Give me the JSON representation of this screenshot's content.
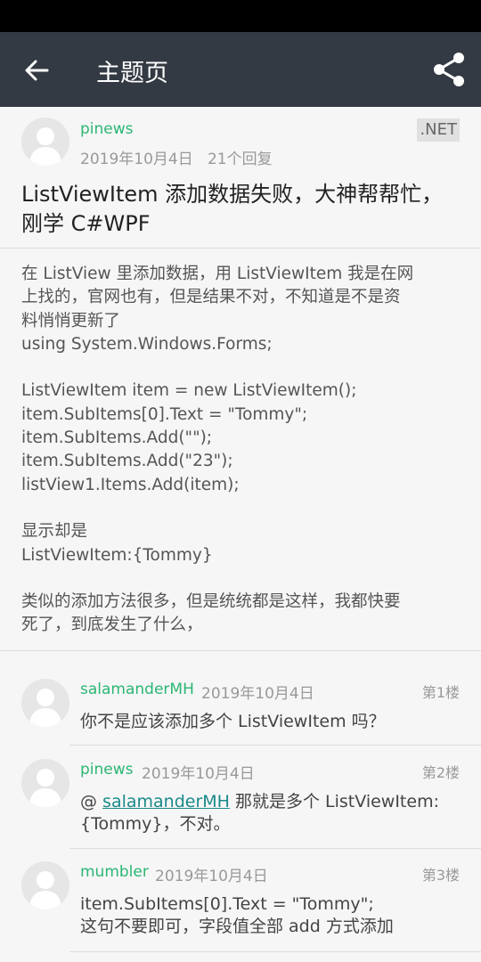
{
  "appbar": {
    "title": "主题页",
    "back_icon": "arrow-left-icon",
    "share_icon": "share-icon"
  },
  "post": {
    "author": "pinews",
    "date": "2019年10月4日",
    "reply_count": "21个回复",
    "tag": ".NET",
    "title": "ListViewItem 添加数据失败，大神帮帮忙，刚学 C#WPF",
    "body_lines": [
      "在 ListView 里添加数据，用 ListViewItem 我是在网",
      "上找的，官网也有，但是结果不对，不知道是不是资",
      "料悄悄更新了",
      "using System.Windows.Forms;",
      "",
      "ListViewItem item = new ListViewItem();",
      "item.SubItems[0].Text = \"Tommy\";",
      "item.SubItems.Add(\"\");",
      "item.SubItems.Add(\"23\");",
      "listView1.Items.Add(item);",
      "",
      "显示却是",
      "ListViewItem:{Tommy}",
      "",
      "类似的添加方法很多，但是统统都是这样，我都快要",
      "死了，到底发生了什么，"
    ]
  },
  "replies": [
    {
      "author": "salamanderMH",
      "date": "2019年10月4日",
      "floor": "第1楼",
      "body": "你不是应该添加多个 ListViewItem 吗？"
    },
    {
      "author": "pinews",
      "date": "2019年10月4日",
      "floor": "第2楼",
      "mention_prefix": "@ ",
      "mention": "salamanderMH",
      "body_after_mention": " 那就是多个 ListViewItem:{Tommy}，不对。"
    },
    {
      "author": "mumbler",
      "date": "2019年10月4日",
      "floor": "第3楼",
      "body_lines": [
        "item.SubItems[0].Text = \"Tommy\";",
        "这句不要即可，字段值全部 add 方式添加"
      ]
    }
  ]
}
